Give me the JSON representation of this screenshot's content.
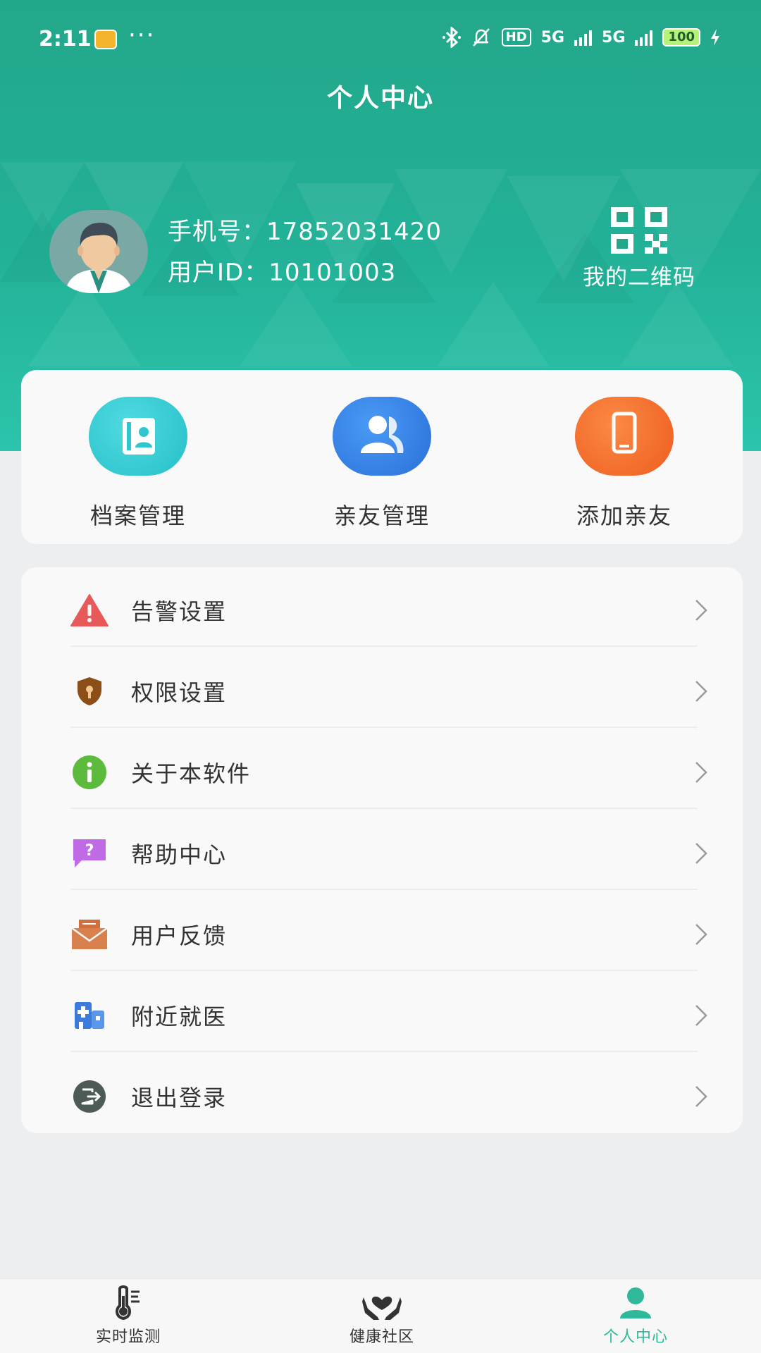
{
  "status_bar": {
    "time": "2:11",
    "dots": "···",
    "hd": "HD",
    "net1": "5G",
    "net2": "5G",
    "battery": "100"
  },
  "header": {
    "title": "个人中心",
    "phone_label": "手机号：",
    "phone_value": "17852031420",
    "userid_label": "用户ID：",
    "userid_value": "10101003",
    "qr_label": "我的二维码"
  },
  "quick_actions": [
    {
      "label": "档案管理",
      "icon": "profile-card-icon",
      "color": "#2fc6cf"
    },
    {
      "label": "亲友管理",
      "icon": "users-icon",
      "color": "#2f7fe6"
    },
    {
      "label": "添加亲友",
      "icon": "phone-icon",
      "color": "#f06a2a"
    }
  ],
  "menu": [
    {
      "label": "告警设置",
      "icon": "warning-icon",
      "color": "#e85a5a"
    },
    {
      "label": "权限设置",
      "icon": "shield-lock-icon",
      "color": "#8a4e16"
    },
    {
      "label": "关于本软件",
      "icon": "info-icon",
      "color": "#5cba3c"
    },
    {
      "label": "帮助中心",
      "icon": "help-icon",
      "color": "#c06ae6"
    },
    {
      "label": "用户反馈",
      "icon": "mail-icon",
      "color": "#cf6f3e"
    },
    {
      "label": "附近就医",
      "icon": "hospital-icon",
      "color": "#3a7bdc"
    },
    {
      "label": "退出登录",
      "icon": "logout-icon",
      "color": "#4d5a55"
    }
  ],
  "tabs": [
    {
      "label": "实时监测",
      "icon": "thermometer-icon",
      "active": false
    },
    {
      "label": "健康社区",
      "icon": "heart-hands-icon",
      "active": false
    },
    {
      "label": "个人中心",
      "icon": "person-icon",
      "active": true
    }
  ],
  "colors": {
    "primary": "#23a78a",
    "active_tab": "#2fb89a"
  }
}
